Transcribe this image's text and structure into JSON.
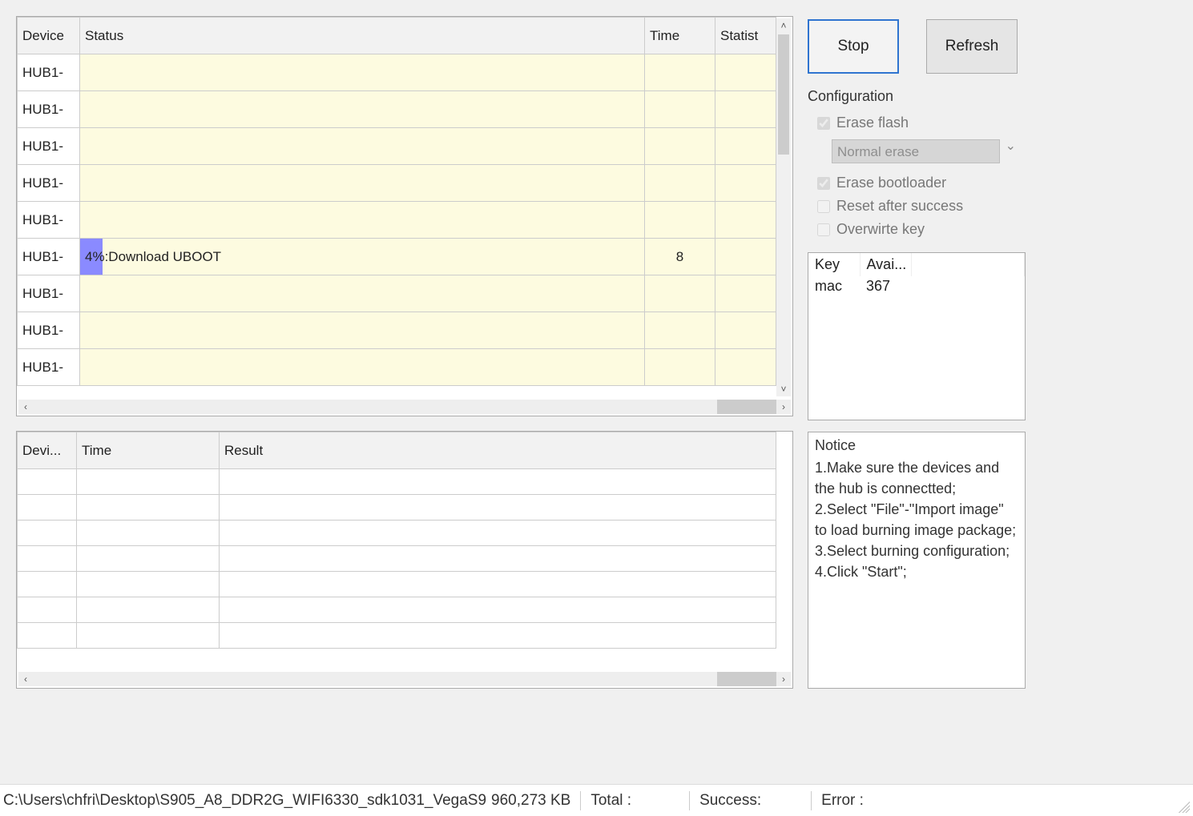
{
  "device_table": {
    "headers": {
      "device": "Device",
      "status": "Status",
      "time": "Time",
      "statistic": "Statist"
    },
    "rows": [
      {
        "device": "HUB1-",
        "status": "",
        "time": "",
        "statistic": "",
        "progress_pct": 0
      },
      {
        "device": "HUB1-",
        "status": "",
        "time": "",
        "statistic": "",
        "progress_pct": 0
      },
      {
        "device": "HUB1-",
        "status": "",
        "time": "",
        "statistic": "",
        "progress_pct": 0
      },
      {
        "device": "HUB1-",
        "status": "",
        "time": "",
        "statistic": "",
        "progress_pct": 0
      },
      {
        "device": "HUB1-",
        "status": "",
        "time": "",
        "statistic": "",
        "progress_pct": 0
      },
      {
        "device": "HUB1-",
        "status": "4%:Download UBOOT",
        "time": "8",
        "statistic": "",
        "progress_pct": 4
      },
      {
        "device": "HUB1-",
        "status": "",
        "time": "",
        "statistic": "",
        "progress_pct": 0
      },
      {
        "device": "HUB1-",
        "status": "",
        "time": "",
        "statistic": "",
        "progress_pct": 0
      },
      {
        "device": "HUB1-",
        "status": "",
        "time": "",
        "statistic": "",
        "progress_pct": 0
      }
    ]
  },
  "result_table": {
    "headers": {
      "device": "Devi...",
      "time": "Time",
      "result": "Result"
    }
  },
  "buttons": {
    "stop": "Stop",
    "refresh": "Refresh"
  },
  "config": {
    "title": "Configuration",
    "erase_flash": {
      "label": "Erase flash",
      "checked": true,
      "disabled": true
    },
    "erase_mode_selected": "Normal erase",
    "erase_bootloader": {
      "label": "Erase bootloader",
      "checked": true,
      "disabled": true
    },
    "reset_after_success": {
      "label": "Reset after success",
      "checked": false,
      "disabled": true
    },
    "overwrite_key": {
      "label": "Overwirte key",
      "checked": false,
      "disabled": true
    }
  },
  "key_table": {
    "headers": {
      "key": "Key",
      "avail": "Avai..."
    },
    "rows": [
      {
        "key": "mac",
        "avail": "367"
      }
    ]
  },
  "notice": {
    "title": "Notice",
    "text": "1.Make sure the devices and the hub is connectted;\n2.Select \"File\"-\"Import image\" to load burning image package;\n3.Select burning configuration;\n4.Click \"Start\";"
  },
  "status_bar": {
    "path": "C:\\Users\\chfri\\Desktop\\S905_A8_DDR2G_WIFI6330_sdk1031_VegaS9",
    "size": "960,273 KB",
    "total_label": "Total :",
    "total_value": "",
    "success_label": "Success:",
    "success_value": "",
    "error_label": "Error :",
    "error_value": ""
  }
}
